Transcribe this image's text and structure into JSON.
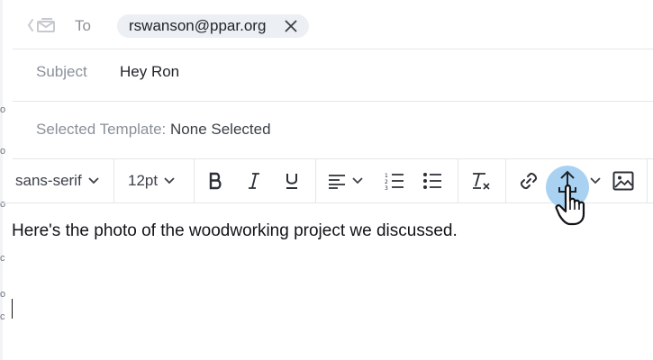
{
  "to": {
    "label": "To",
    "recipient": "rswanson@ppar.org"
  },
  "subject": {
    "label": "Subject",
    "value": "Hey Ron"
  },
  "template": {
    "label": "Selected Template:",
    "value": " None Selected"
  },
  "toolbar": {
    "font_family": "sans-serif",
    "font_size": "12pt",
    "icons": [
      "bold-icon",
      "italic-icon",
      "underline-icon",
      "align-left-icon",
      "numbered-list-icon",
      "bulleted-list-icon",
      "clear-format-icon",
      "link-icon",
      "upload-icon",
      "image-icon"
    ]
  },
  "body": {
    "text": "Here's the photo of the woodworking project we discussed."
  },
  "colors": {
    "hover": "#a9d2f2",
    "label": "#8a9099",
    "chip": "#eceff3",
    "border": "#e4e6ea"
  },
  "left_edge": [
    "o",
    "o",
    "o",
    "c",
    "o",
    "c"
  ]
}
